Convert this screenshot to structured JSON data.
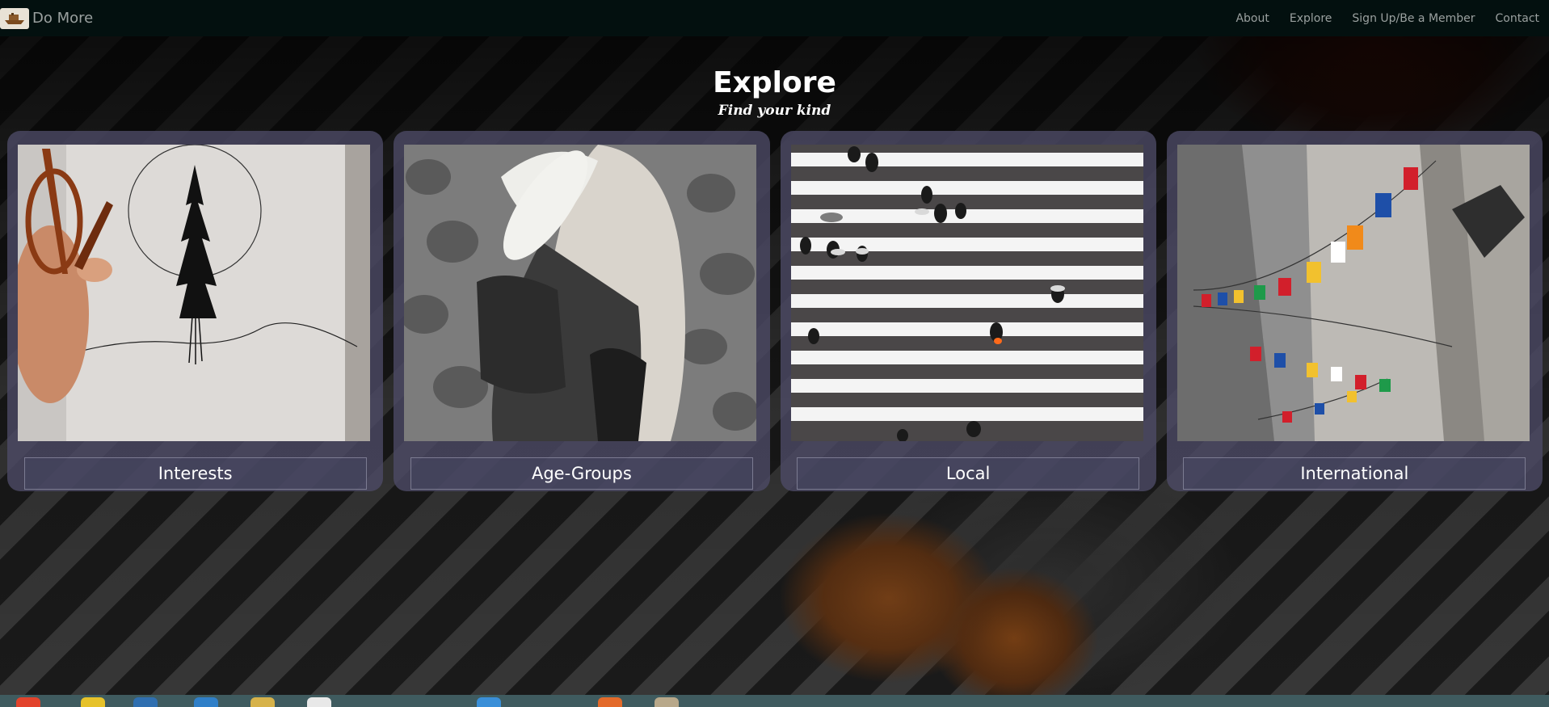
{
  "navbar": {
    "brand": "Do More",
    "brand_icon": "boat-logo-icon",
    "links": [
      "About",
      "Explore",
      "Sign Up/Be a Member",
      "Contact"
    ]
  },
  "header": {
    "title": "Explore",
    "subtitle": "Find your kind"
  },
  "cards": [
    {
      "label": "Interests",
      "image": "sketchbook-tree-drawing"
    },
    {
      "label": "Age-Groups",
      "image": "mother-hugging-child"
    },
    {
      "label": "Local",
      "image": "crosswalk-pedestrians"
    },
    {
      "label": "International",
      "image": "alley-with-flags"
    }
  ],
  "colors": {
    "navbar": "#03100f",
    "card": "#4e4c68",
    "text": "#ffffff",
    "nav_text": "#9aa09f"
  }
}
